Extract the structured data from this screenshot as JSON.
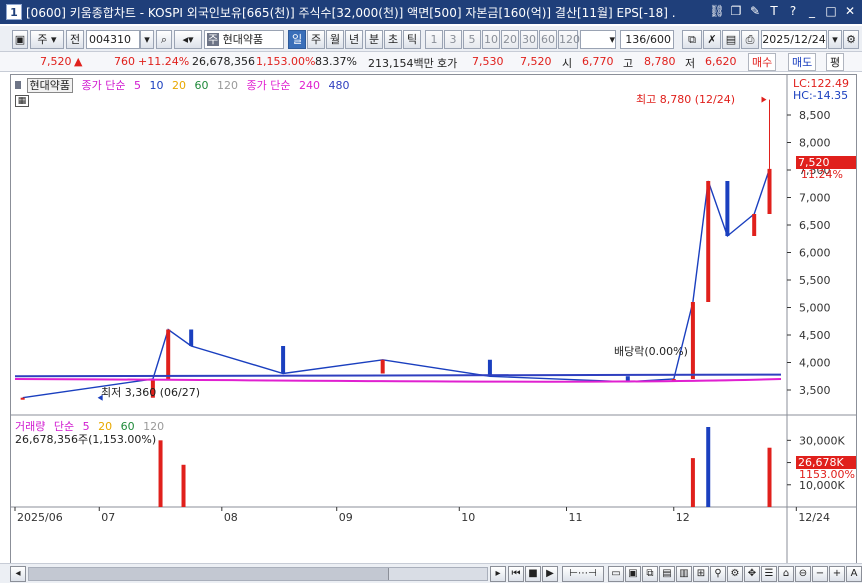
{
  "window": {
    "number": "1",
    "title": "[0600] 키움종합차트 - KOSPI 외국인보유[665(천)] 주식수[32,000(천)] 액면[500] 자본금[160(억)] 결산[11월] EPS[-18] ."
  },
  "toolbar": {
    "period_kind": "주",
    "total_label": "전",
    "code": "004310",
    "stock_tag": "주",
    "stock_name": "현대약품",
    "tabs": [
      "일",
      "주",
      "월",
      "년",
      "분",
      "초",
      "틱"
    ],
    "active_tab": "일",
    "intervals": [
      "1",
      "3",
      "5",
      "10",
      "20",
      "30",
      "60",
      "120"
    ],
    "count": "136/600",
    "date": "2025/12/24"
  },
  "quote": {
    "price": "7,520",
    "arrow": "▲",
    "change": "760",
    "change_rate": "+11.24%",
    "volume": "26,678,356",
    "volume_rate": "1,153.00%",
    "ratio": "83.37%",
    "amount": "213,154백만",
    "ask_label": "호가",
    "ask": "7,530",
    "bid": "7,520",
    "open_label": "시",
    "open": "6,770",
    "high_label": "고",
    "high": "8,780",
    "low_label": "저",
    "low": "6,620",
    "buy": "매수",
    "sell": "매도",
    "misc": "평"
  },
  "price_panel": {
    "stock_tag": "현대약품",
    "ma_label": "종가 단순",
    "ma_periods": [
      "5",
      "10",
      "20",
      "60",
      "120"
    ],
    "ma_label2": "종가 단순",
    "ma_periods2": [
      "240",
      "480"
    ],
    "lc": "LC:122.49",
    "hc": "HC:-14.35",
    "current_price_tag": "7,520",
    "current_rate_tag": "11.24%",
    "high_annotation": "최고 8,780 (12/24)",
    "low_annotation": "최저 3,360 (06/27)",
    "dividend_annotation": "배당락(0.00%)"
  },
  "volume_panel": {
    "label": "거래량",
    "ma_label": "단순",
    "ma_periods": [
      "5",
      "20",
      "60",
      "120"
    ],
    "current": "26,678,356주(1,153.00%)",
    "current_tag": "26,678K",
    "current_rate_tag": "1153.00%"
  },
  "colors": {
    "up": "#e0201c",
    "down": "#1a3fbf",
    "ma5": "#d01ad0",
    "ma10": "#1a3fbf",
    "ma20": "#e8a800",
    "ma60": "#1f8a3a",
    "ma120": "#7a7a7a",
    "ma240": "#e020d0",
    "ma480": "#2f3fbf"
  },
  "chart_data": [
    {
      "type": "line",
      "title": "현대약품 일봉",
      "x_ticks": [
        "2025/06",
        "07",
        "08",
        "09",
        "10",
        "11",
        "12",
        "12/24"
      ],
      "ylim": [
        3300,
        8900
      ],
      "y_ticks": [
        3500,
        4000,
        4500,
        5000,
        5500,
        6000,
        6500,
        7000,
        7500,
        8000,
        8500
      ],
      "grid": false,
      "series": [
        {
          "name": "종가",
          "points": [
            {
              "x": "06/27",
              "y": 3360
            },
            {
              "x": "07/14",
              "y": 3700
            },
            {
              "x": "07/21",
              "y": 4600
            },
            {
              "x": "07/24",
              "y": 4300
            },
            {
              "x": "08",
              "y": 3800
            },
            {
              "x": "09",
              "y": 4050
            },
            {
              "x": "10",
              "y": 3750
            },
            {
              "x": "11",
              "y": 3650
            },
            {
              "x": "12/03",
              "y": 3700
            },
            {
              "x": "12/05",
              "y": 5100
            },
            {
              "x": "12/08",
              "y": 7300
            },
            {
              "x": "12/15",
              "y": 6300
            },
            {
              "x": "12/22",
              "y": 6700
            },
            {
              "x": "12/24",
              "y": 7520
            }
          ]
        }
      ]
    },
    {
      "type": "bar",
      "title": "거래량",
      "ylim": [
        0,
        36000
      ],
      "y_ticks": [
        10000,
        20000,
        30000
      ],
      "series": [
        {
          "name": "거래량(K)",
          "points": [
            {
              "x": "07/14",
              "y": 30000
            },
            {
              "x": "07/22",
              "y": 19000
            },
            {
              "x": "12/05",
              "y": 22000
            },
            {
              "x": "12/08",
              "y": 36000
            },
            {
              "x": "12/24",
              "y": 26678
            }
          ]
        }
      ]
    }
  ]
}
